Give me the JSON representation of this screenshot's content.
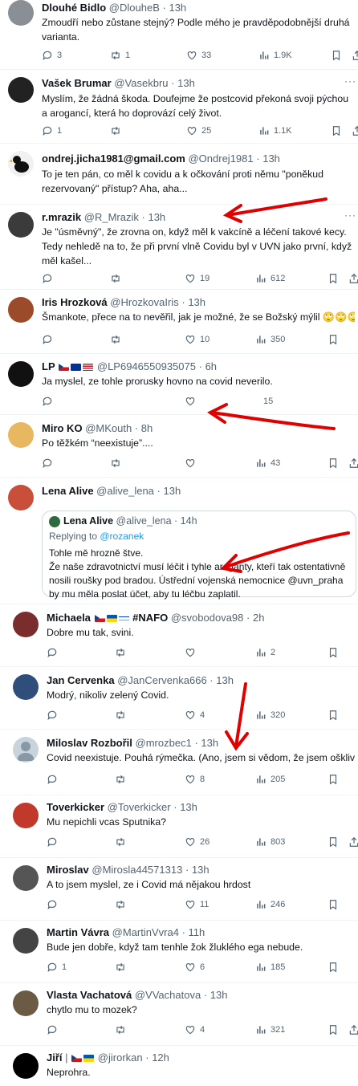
{
  "tweets": [
    {
      "name": "Dlouhé Bidlo",
      "handle": "@DlouheB",
      "time": "13h",
      "text": "Zmoudří nebo zůstane stejný? Podle mého je pravděpodobnější druhá varianta.",
      "replies": "3",
      "retweets": "1",
      "likes": "33",
      "views": "1.9K",
      "avatar_color": "#8a8f96"
    },
    {
      "name": "Vašek Brumar",
      "handle": "@Vasekbru",
      "time": "13h",
      "text": "Myslím, že žádná škoda. Doufejme že postcovid překoná svoji pýchou a arogancí, která ho doprovází celý život.",
      "replies": "1",
      "retweets": "",
      "likes": "25",
      "views": "1.1K",
      "avatar_color": "#222222"
    },
    {
      "name": "ondrej.jicha1981@gmail.com",
      "handle": "@Ondrej1981",
      "time": "13h",
      "text": "To je ten pán, co měl k covidu a k očkování proti němu \"poněkud rezervovaný\" přístup? Aha, aha...",
      "replies": "",
      "retweets": "",
      "likes": "",
      "views": "",
      "avatar_color": "#f1f1f1"
    },
    {
      "name": "r.mrazik",
      "handle": "@R_Mrazik",
      "time": "13h",
      "text": "Je \"úsměvný\", že zrovna on, když měl k vakcíně a léčení takové kecy.\nTedy nehledě na to, že při první vlně Covidu byl v UVN jako první, když měl kašel...",
      "replies": "",
      "retweets": "",
      "likes": "19",
      "views": "612",
      "avatar_color": "#3b3b3b"
    },
    {
      "name": "Iris Hrozková",
      "handle": "@HrozkovaIris",
      "time": "13h",
      "text": "Šmankote, přece na to nevěřil, jak je možné, že se Božský mýlil 🙄🙄🙄",
      "replies": "",
      "retweets": "",
      "likes": "10",
      "views": "350",
      "avatar_color": "#9b4a2a"
    },
    {
      "name": "LP",
      "handle": "@LP6946550935075",
      "time": "6h",
      "text": "Ja myslel, ze tohle prorusky hovno na covid neverilo.",
      "replies": "",
      "retweets": "",
      "likes": "",
      "views": "15",
      "avatar_color": "#111111"
    },
    {
      "name": "Miro KO",
      "handle": "@MKouth",
      "time": "8h",
      "text": "Po těžkém “neexistuje”....",
      "replies": "",
      "retweets": "",
      "likes": "",
      "views": "43",
      "avatar_color": "#e8b860"
    },
    {
      "name": "Lena Alive",
      "handle": "@alive_lena",
      "time": "13h",
      "text": "",
      "avatar_color": "#c94f3a",
      "quote": {
        "name": "Lena Alive",
        "handle": "@alive_lena",
        "time": "14h",
        "reply_prefix": "Replying to ",
        "reply_to": "@rozanek",
        "text": "Tohle mě hrozně štve.\nŽe naše zdravotnictví musí léčit i tyhle aroganty, kteří tak ostentativně nosili roušky pod bradou. Ústřední vojenská nemocnice @uvn_praha by mu měla poslat účet, aby tu léčbu zaplatil."
      }
    },
    {
      "name": "Michaela",
      "name_suffix": "#NAFO",
      "handle": "@svobodova98",
      "time": "2h",
      "text": "Dobre mu tak, svini.",
      "replies": "",
      "retweets": "",
      "likes": "",
      "views": "2",
      "avatar_color": "#7a2d2d"
    },
    {
      "name": "Jan Cervenka",
      "handle": "@JanCervenka666",
      "time": "13h",
      "text": "Modrý, nikoliv zelený Covid.",
      "replies": "",
      "retweets": "",
      "likes": "4",
      "views": "320",
      "avatar_color": "#2f4f7a"
    },
    {
      "name": "Miloslav Rozbořil",
      "handle": "@mrozbec1",
      "time": "13h",
      "text": "Covid neexistuje. Pouhá rýmečka. (Ano, jsem si vědom, že jsem ošklivý.)",
      "replies": "",
      "retweets": "",
      "likes": "8",
      "views": "205",
      "avatar_color": "#c9d3dc"
    },
    {
      "name": "Toverkicker",
      "handle": "@Toverkicker",
      "time": "13h",
      "text": "Mu nepichli vcas Sputnika?",
      "replies": "",
      "retweets": "",
      "likes": "26",
      "views": "803",
      "avatar_color": "#c0392b"
    },
    {
      "name": "Miroslav",
      "handle": "@Mirosla44571313",
      "time": "13h",
      "text": "A to jsem myslel, ze i Covid má nějakou hrdost",
      "replies": "",
      "retweets": "",
      "likes": "11",
      "views": "246",
      "avatar_color": "#555555"
    },
    {
      "name": "Martin Vávra",
      "handle": "@MartinVvra4",
      "time": "11h",
      "text": "Bude jen dobře, když tam tenhle žok žluklého ega nebude.",
      "replies": "1",
      "retweets": "",
      "likes": "6",
      "views": "185",
      "avatar_color": "#444444"
    },
    {
      "name": "Vlasta Vachatová",
      "handle": "@VVachatova",
      "time": "13h",
      "text": "chytlo mu to mozek?",
      "replies": "",
      "retweets": "",
      "likes": "4",
      "views": "321",
      "avatar_color": "#6b5a44"
    },
    {
      "name": "Jiří",
      "handle": "@jirorkan",
      "time": "12h",
      "text": "Neprohra.",
      "avatar_color": "#000000"
    }
  ],
  "more_label": "···"
}
